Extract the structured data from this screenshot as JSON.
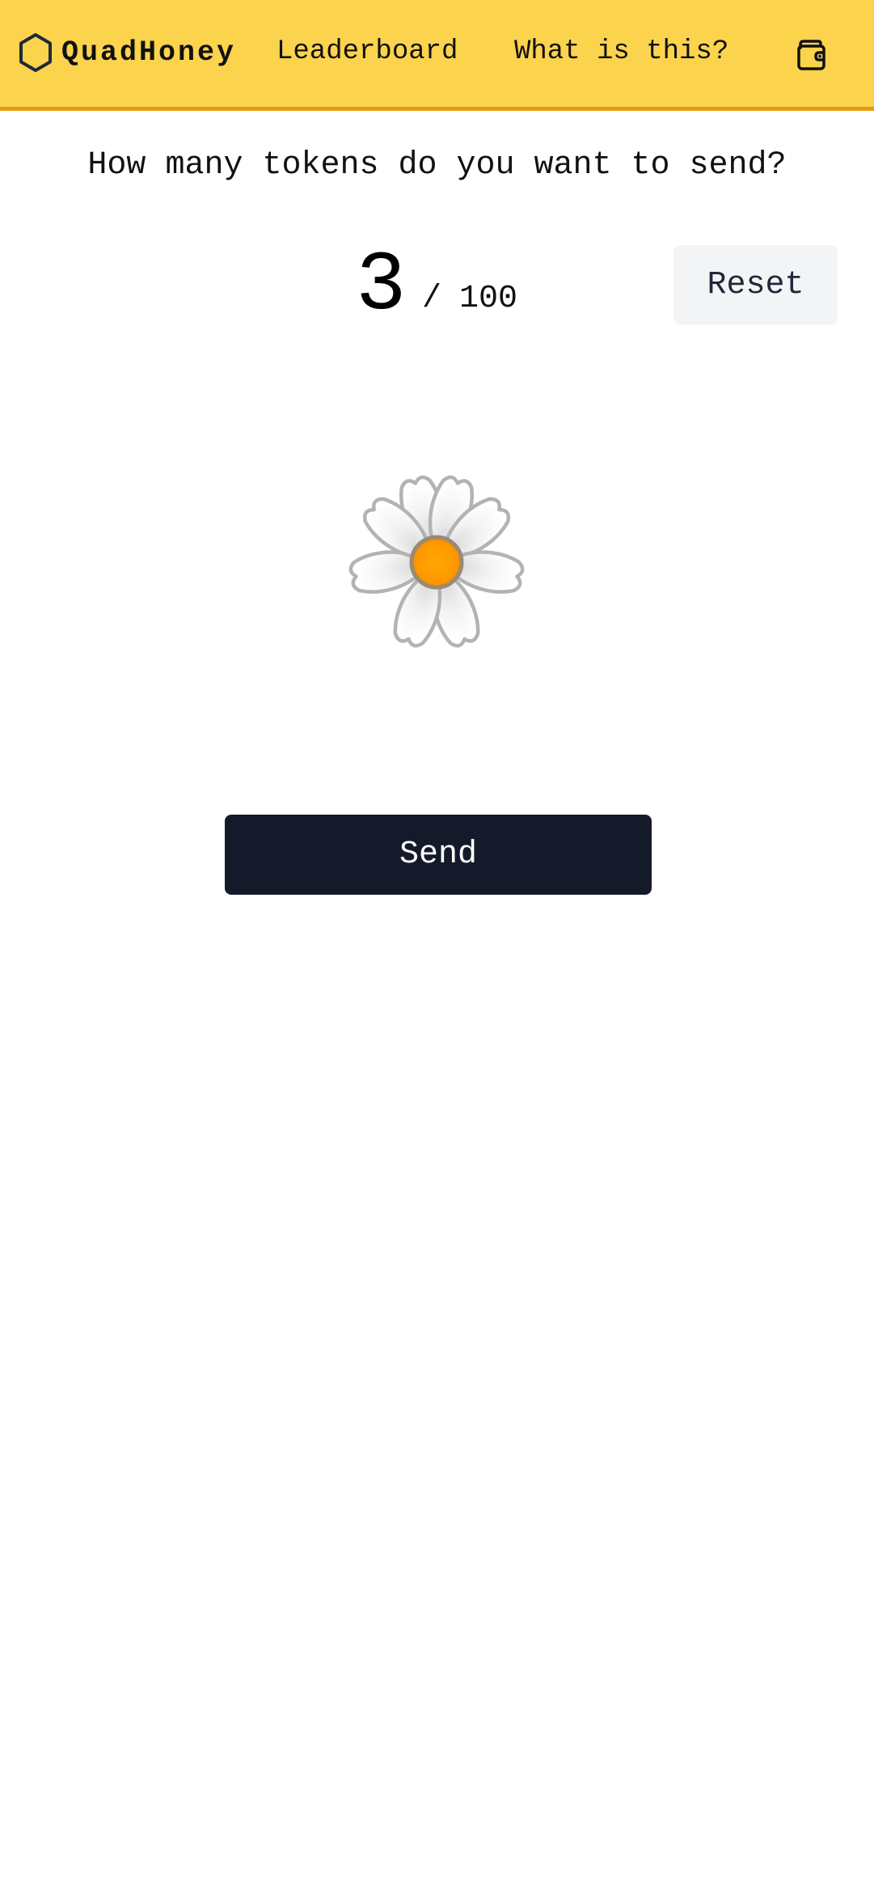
{
  "header": {
    "brand_name": "QuadHoney",
    "logo_icon": "hexagon-icon",
    "nav": [
      {
        "label": "Leaderboard"
      },
      {
        "label": "What is this?"
      }
    ],
    "wallet_icon": "wallet-icon"
  },
  "main": {
    "prompt": "How many tokens do you want to send?",
    "count": "3",
    "separator": "/",
    "max": "100",
    "reset_label": "Reset",
    "flower_icon": "daisy-icon",
    "send_label": "Send"
  },
  "colors": {
    "header_bg": "#fcd34d",
    "header_border": "#e49a16",
    "send_bg": "#141a29",
    "reset_bg": "#f3f4f6",
    "flower_center": "#ff9f00"
  }
}
